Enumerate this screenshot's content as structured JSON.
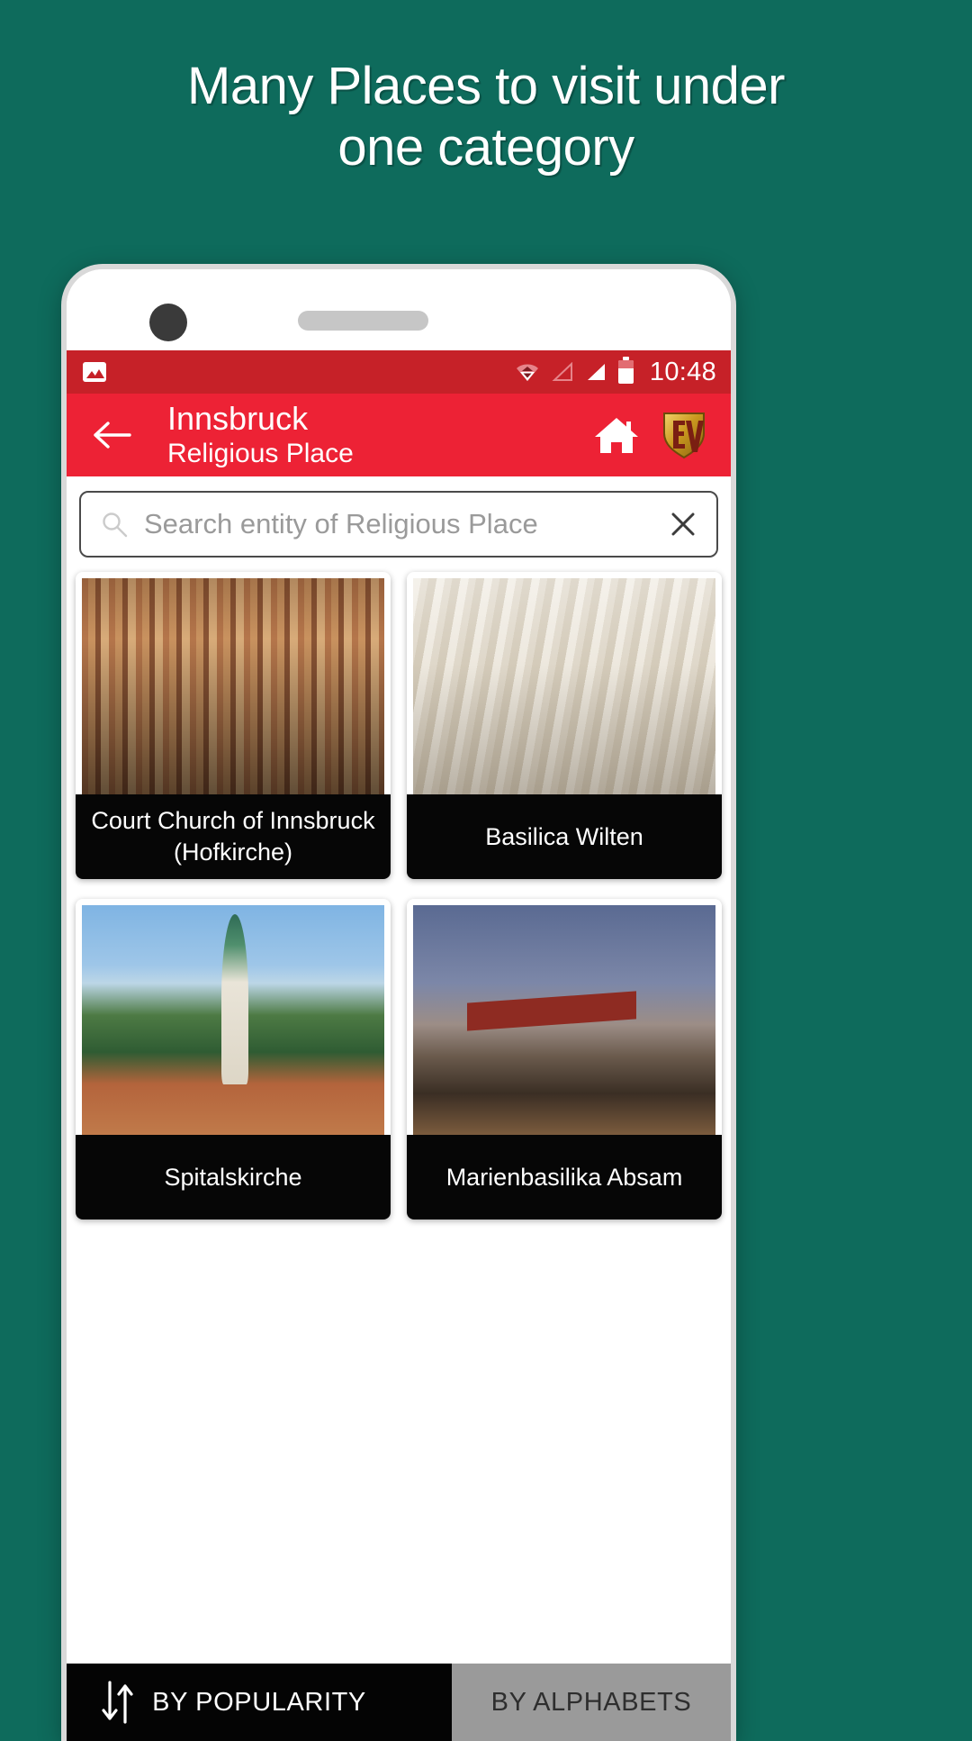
{
  "promo": {
    "headline_line1": "Many Places to visit under",
    "headline_line2": "one category",
    "background_color": "#0e6b5c"
  },
  "statusbar": {
    "time": "10:48",
    "icons": [
      "photo-icon",
      "wifi-icon",
      "signal-empty-icon",
      "signal-full-icon",
      "battery-icon"
    ]
  },
  "appbar": {
    "back_icon": "back-arrow-icon",
    "title": "Innsbruck",
    "subtitle": "Religious Place",
    "home_icon": "home-icon",
    "logo_text": "EV",
    "background_color": "#ed2235"
  },
  "search": {
    "placeholder": "Search entity of Religious Place",
    "value": "",
    "search_icon": "search-icon",
    "clear_icon": "close-icon"
  },
  "cards": [
    {
      "title": "Court Church of Innsbruck (Hofkirche)",
      "photo": "church-interior-photo"
    },
    {
      "title": "Basilica Wilten",
      "photo": "basilica-interior-photo"
    },
    {
      "title": "Spitalskirche",
      "photo": "church-tower-mountains-photo"
    },
    {
      "title": "Marienbasilika Absam",
      "photo": "hotel-building-dusk-photo"
    }
  ],
  "sortbar": {
    "sort_icon": "sort-arrows-icon",
    "tabs": [
      {
        "label": "BY POPULARITY",
        "active": true
      },
      {
        "label": "BY ALPHABETS",
        "active": false
      }
    ]
  }
}
